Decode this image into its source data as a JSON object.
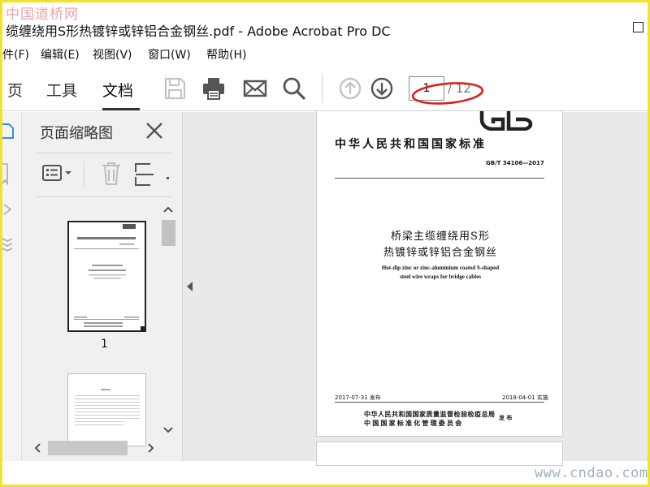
{
  "watermark_top": "中国道桥网",
  "watermark_bottom": "www.cndao.com",
  "window": {
    "title": "缆缠绕用S形热镀锌或锌铝合金钢丝.pdf - Adobe Acrobat Pro DC"
  },
  "menu": {
    "items": [
      {
        "label": "件(F)"
      },
      {
        "label": "编辑(E)"
      },
      {
        "label": "视图(V)"
      },
      {
        "label": "窗口(W)"
      },
      {
        "label": "帮助(H)"
      }
    ]
  },
  "toolbar": {
    "tabs": [
      {
        "label": "页"
      },
      {
        "label": "工具"
      },
      {
        "label": "文档",
        "active": true
      }
    ],
    "icons": [
      "save-icon",
      "print-icon",
      "email-icon",
      "search-icon",
      "prev-page-icon",
      "next-page-icon"
    ],
    "page_input": "1",
    "page_total": "/ 12"
  },
  "thumbnail_pane": {
    "title": "页面缩略图",
    "thumbnails": [
      {
        "label": "1"
      }
    ]
  },
  "document": {
    "logo": "GB",
    "standard_title": "中华人民共和国国家标准",
    "standard_code": "GB/T 34106—2017",
    "title_cn_line1": "桥梁主缆缠绕用S形",
    "title_cn_line2": "热镀锌或锌铝合金钢丝",
    "title_en_line1": "Hot-dip zinc or zinc-aluminium coated S-shaped",
    "title_en_line2": "steel wire wraps for bridge cables",
    "issue_date": "2017-07-31 发布",
    "implement_date": "2018-04-01 实施",
    "issuer_line1": "中华人民共和国国家质量监督检验检疫总局",
    "issuer_line2": "中国国家标准化管理委员会",
    "issue_word": "发 布"
  },
  "colors": {
    "frame": "#f2e22a",
    "annotation": "#e02020",
    "doc_background": "#e9e9e9"
  }
}
